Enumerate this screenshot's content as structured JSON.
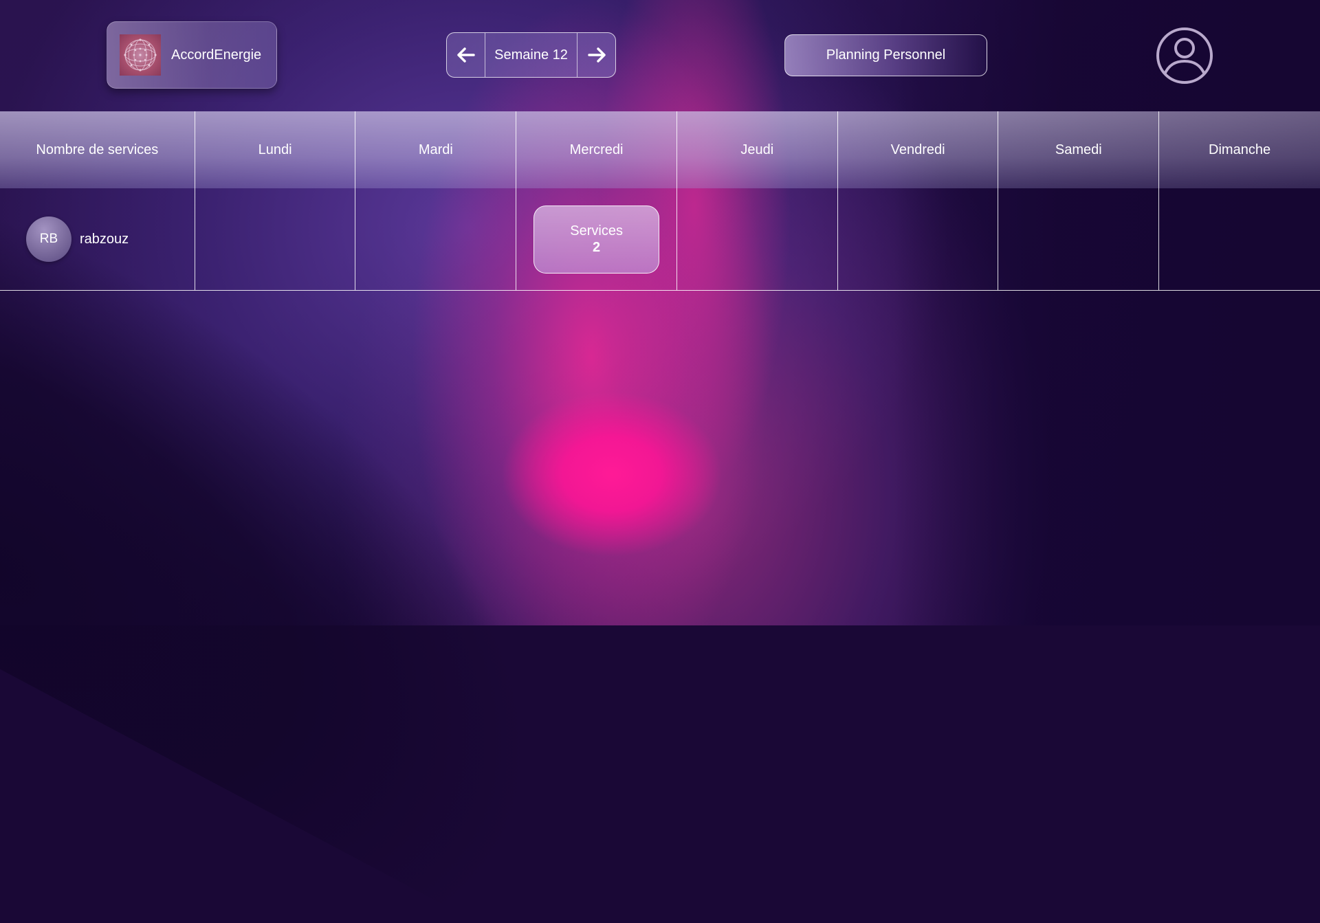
{
  "header": {
    "brand_name": "AccordEnergie",
    "week_label": "Semaine 12",
    "planning_button": "Planning Personnel"
  },
  "table": {
    "columns": [
      "Nombre de services",
      "Lundi",
      "Mardi",
      "Mercredi",
      "Jeudi",
      "Vendredi",
      "Samedi",
      "Dimanche"
    ],
    "rows": [
      {
        "initials": "RB",
        "name": "rabzouz",
        "services": {
          "wednesday": {
            "label": "Services",
            "count": "2"
          }
        }
      }
    ]
  },
  "icons": {
    "prev": "arrow-left-icon",
    "next": "arrow-right-icon",
    "user": "user-circle-icon",
    "logo": "brand-logo"
  },
  "colors": {
    "background": "#1a0836",
    "accent_pink": "#ff1a96",
    "accent_purple": "#5a3c9a"
  }
}
